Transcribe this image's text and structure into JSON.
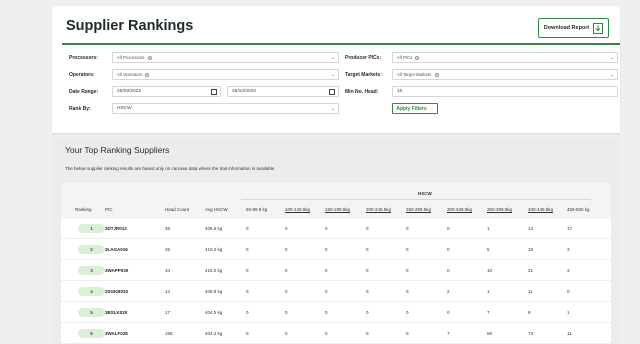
{
  "header": {
    "title": "Supplier Rankings",
    "download_label": "Download Report"
  },
  "filters": {
    "processors_label": "Processors:",
    "processors_value": "All Processors",
    "producer_pics_label": "Producer PICs:",
    "producer_pics_value": "All PICs",
    "operators_label": "Operators:",
    "operators_value": "All Operators",
    "target_markets_label": "Target Markets:",
    "target_markets_value": "All Target Markets",
    "date_range_label": "Date Range:",
    "date_from": "25/09/2022",
    "date_to": "25/10/2022",
    "min_head_label": "Min No. Head:",
    "min_head_value": "10",
    "rank_by_label": "Rank By:",
    "rank_by_value": "HSCW",
    "apply_label": "Apply Filters",
    "apply_icon": "arrow-right-icon"
  },
  "results": {
    "title": "Your Top Ranking Suppliers",
    "note": "The below supplier ranking results are based only on carcase data where the trait information is available.",
    "group_header": "HSCW",
    "columns": [
      "Ranking",
      "PIC",
      "Head Count",
      "Avg HSCW",
      "50-99.5 kg",
      "100-149.5kg",
      "150-199.5kg",
      "200-249.5kg",
      "250-299.5kg",
      "300-349.5kg",
      "350-399.5kg",
      "400-449.5kg",
      "450-500 kg"
    ],
    "rows": [
      {
        "rank": "1",
        "pic": "3DTJR012",
        "head": "35",
        "avg": "405.6 kg",
        "b": [
          "0",
          "0",
          "0",
          "0",
          "0",
          "0",
          "1",
          "14",
          "17"
        ]
      },
      {
        "rank": "2",
        "pic": "3LAGA016",
        "head": "26",
        "avg": "410.2 kg",
        "b": [
          "0",
          "0",
          "0",
          "0",
          "0",
          "0",
          "5",
          "18",
          "3"
        ]
      },
      {
        "rank": "3",
        "pic": "3WAPP030",
        "head": "34",
        "avg": "415.0 kg",
        "b": [
          "0",
          "0",
          "0",
          "0",
          "0",
          "0",
          "10",
          "21",
          "3"
        ]
      },
      {
        "rank": "4",
        "pic": "3SGKB033",
        "head": "14",
        "avg": "408.9 kg",
        "b": [
          "0",
          "0",
          "0",
          "0",
          "0",
          "2",
          "1",
          "11",
          "0"
        ]
      },
      {
        "rank": "5",
        "pic": "3BSLK020",
        "head": "17",
        "avg": "404.5 kg",
        "b": [
          "0",
          "0",
          "0",
          "0",
          "0",
          "0",
          "7",
          "9",
          "1"
        ]
      },
      {
        "rank": "6",
        "pic": "3WALF028",
        "head": "158",
        "avg": "404.2 kg",
        "b": [
          "0",
          "0",
          "0",
          "0",
          "0",
          "7",
          "68",
          "73",
          "11"
        ]
      }
    ]
  },
  "colors": {
    "accent": "#2f8a3f",
    "rank_pill_bg": "#dbefd8",
    "page_bg": "#eef0f0"
  }
}
